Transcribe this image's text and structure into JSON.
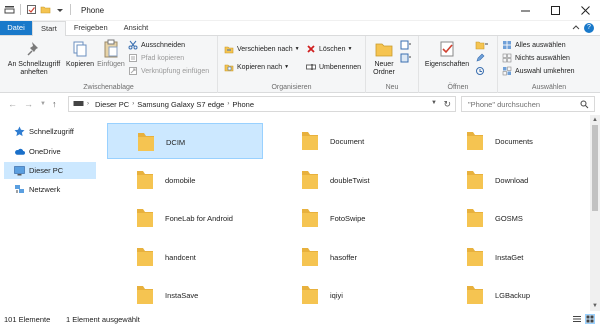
{
  "window": {
    "title": "Phone"
  },
  "ribbon_tabs": [
    "Datei",
    "Start",
    "Freigeben",
    "Ansicht"
  ],
  "ribbon": {
    "zwischenablage": {
      "label": "Zwischenablage",
      "pin": "An Schnellzugriff anheften",
      "copy": "Kopieren",
      "paste": "Einfügen",
      "cut": "Ausschneiden",
      "copy_path": "Pfad kopieren",
      "paste_shortcut": "Verknüpfung einfügen"
    },
    "organisieren": {
      "label": "Organisieren",
      "move_to": "Verschieben nach",
      "copy_to": "Kopieren nach",
      "delete": "Löschen",
      "rename": "Umbenennen"
    },
    "neu": {
      "label": "Neu",
      "new_folder": "Neuer Ordner"
    },
    "oeffnen": {
      "label": "Öffnen",
      "properties": "Eigenschaften"
    },
    "auswaehlen": {
      "label": "Auswählen",
      "select_all": "Alles auswählen",
      "select_none": "Nichts auswählen",
      "invert": "Auswahl umkehren"
    }
  },
  "address": {
    "crumbs": [
      "Dieser PC",
      "Samsung Galaxy S7 edge",
      "Phone"
    ],
    "search_placeholder": "\"Phone\" durchsuchen"
  },
  "nav": {
    "items": [
      {
        "label": "Schnellzugriff",
        "icon": "star-icon",
        "selected": false
      },
      {
        "label": "OneDrive",
        "icon": "cloud-icon",
        "selected": false
      },
      {
        "label": "Dieser PC",
        "icon": "computer-icon",
        "selected": true
      },
      {
        "label": "Netzwerk",
        "icon": "network-icon",
        "selected": false
      }
    ]
  },
  "folders": [
    "DCIM",
    "Document",
    "Documents",
    "domobile",
    "doubleTwist",
    "Download",
    "FoneLab for Android",
    "FotoSwipe",
    "GOSMS",
    "handcent",
    "hasoffer",
    "InstaGet",
    "InstaSave",
    "iqiyi",
    "LGBackup"
  ],
  "status": {
    "count": "101 Elemente",
    "selected": "1 Element ausgewählt"
  },
  "colors": {
    "accent": "#1979ca",
    "selection": "#cce8ff",
    "folder": "#f5c451"
  }
}
